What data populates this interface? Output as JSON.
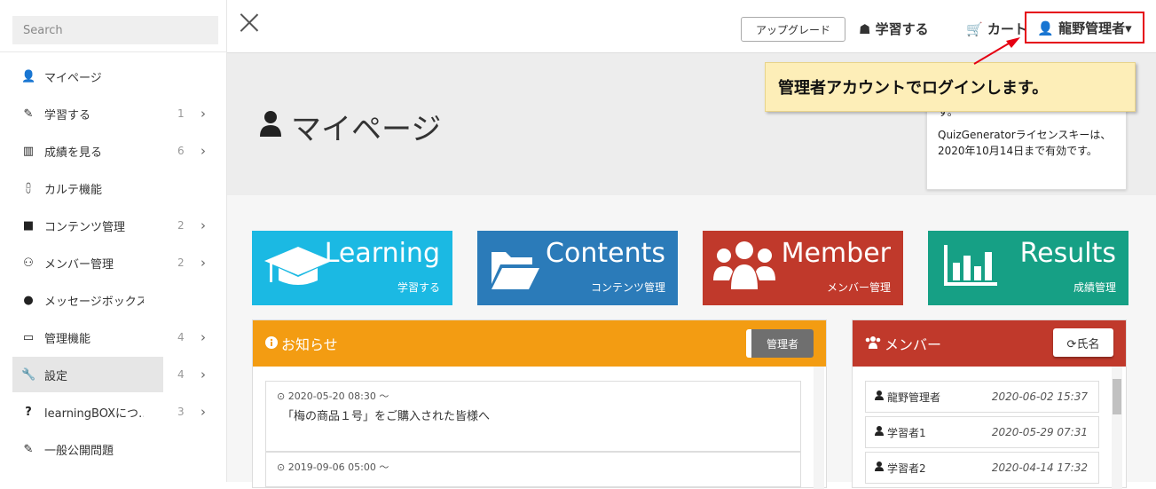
{
  "sidebar": {
    "search_placeholder": "Search",
    "items": [
      {
        "icon": "user-icon",
        "glyph": "👤",
        "label": "マイページ",
        "count": "",
        "chevron": ""
      },
      {
        "icon": "pencil-icon",
        "glyph": "✎",
        "label": "学習する",
        "count": "1",
        "chevron": "›"
      },
      {
        "icon": "bar-chart-icon",
        "glyph": "▥",
        "label": "成績を見る",
        "count": "6",
        "chevron": "›"
      },
      {
        "icon": "sitemap-icon",
        "glyph": "⩉",
        "label": "カルテ機能",
        "count": "",
        "chevron": ""
      },
      {
        "icon": "folder-icon",
        "glyph": "■",
        "label": "コンテンツ管理",
        "count": "2",
        "chevron": "›"
      },
      {
        "icon": "users-icon",
        "glyph": "⚇",
        "label": "メンバー管理",
        "count": "2",
        "chevron": "›"
      },
      {
        "icon": "comments-icon",
        "glyph": "●",
        "label": "メッセージボックス",
        "count": "",
        "chevron": ""
      },
      {
        "icon": "desktop-icon",
        "glyph": "▭",
        "label": "管理機能",
        "count": "4",
        "chevron": "›"
      },
      {
        "icon": "wrench-icon",
        "glyph": "🔧",
        "label": "設定",
        "count": "4",
        "chevron": "›"
      },
      {
        "icon": "question-icon",
        "glyph": "?",
        "label": "learningBOXにつ…",
        "count": "3",
        "chevron": "›"
      },
      {
        "icon": "pencil-icon",
        "glyph": "✎",
        "label": "一般公開問題",
        "count": "",
        "chevron": ""
      }
    ]
  },
  "topbar": {
    "upgrade": "アップグレード",
    "learn": "☗ 学習する",
    "cart": "🛒 カート",
    "user": "👤 龍野管理者▾"
  },
  "callout": "管理者アカウントでログインします。",
  "hero": {
    "title": "マイページ",
    "license_line1": "す。",
    "license_line2": "QuizGeneratorライセンスキーは、2020年10月14日まで有効です。"
  },
  "tiles": [
    {
      "big": "Learning",
      "small": "学習する",
      "color": "#1bb9e3",
      "icon": "graduation-cap-icon"
    },
    {
      "big": "Contents",
      "small": "コンテンツ管理",
      "color": "#2b7bb9",
      "icon": "folder-open-icon"
    },
    {
      "big": "Member",
      "small": "メンバー管理",
      "color": "#c0392b",
      "icon": "users-icon"
    },
    {
      "big": "Results",
      "small": "成績管理",
      "color": "#16a085",
      "icon": "bar-chart-icon"
    }
  ],
  "notice": {
    "title": "お知らせ",
    "tag": "管理者",
    "color": "#f39c12",
    "items": [
      {
        "date": "⊙ 2020-05-20 08:30 ～",
        "title": "「梅の商品１号」をご購入された皆様へ"
      },
      {
        "date": "⊙ 2019-09-06 05:00 ～",
        "title": ""
      }
    ]
  },
  "members": {
    "title": "メンバー",
    "sort": "⟳氏名",
    "color": "#c0392b",
    "rows": [
      {
        "name": "龍野管理者",
        "date": "2020-06-02 15:37"
      },
      {
        "name": "学習者1",
        "date": "2020-05-29 07:31"
      },
      {
        "name": "学習者2",
        "date": "2020-04-14 17:32"
      }
    ]
  }
}
